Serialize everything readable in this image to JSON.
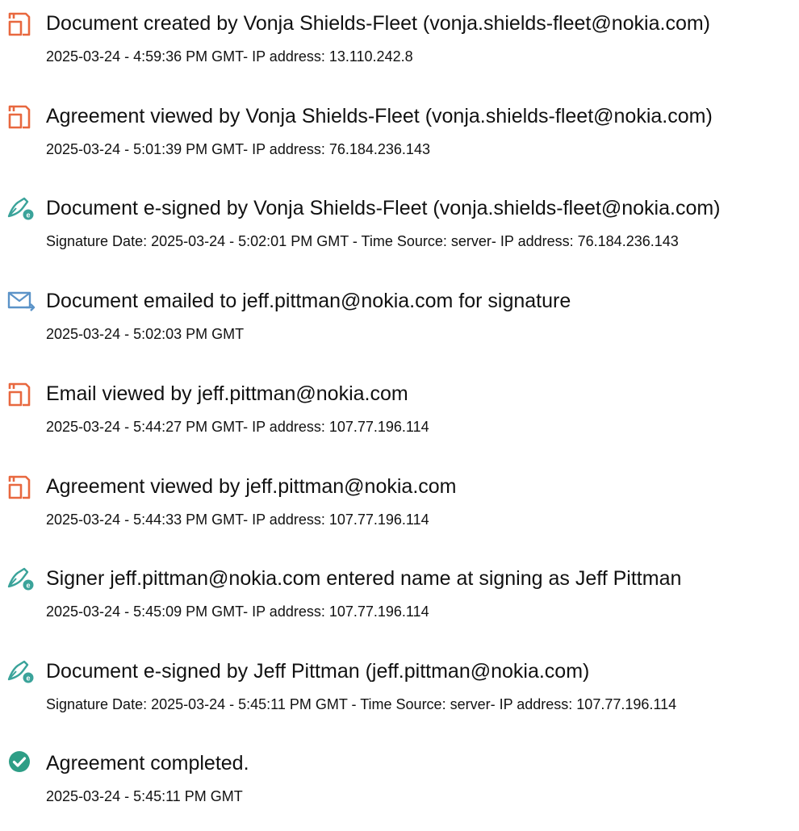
{
  "colors": {
    "document_icon": "#e8683f",
    "sign_icon": "#3aa39a",
    "email_icon": "#5b93c8",
    "complete_icon": "#2e9e86",
    "text": "#111111"
  },
  "events": [
    {
      "icon": "document-icon",
      "title": "Document created by Vonja Shields-Fleet (vonja.shields-fleet@nokia.com)",
      "detail": "2025-03-24 - 4:59:36 PM GMT- IP address: 13.110.242.8"
    },
    {
      "icon": "document-icon",
      "title": "Agreement viewed by Vonja Shields-Fleet (vonja.shields-fleet@nokia.com)",
      "detail": "2025-03-24 - 5:01:39 PM GMT- IP address: 76.184.236.143"
    },
    {
      "icon": "e-sign-pen-icon",
      "title": "Document e-signed by Vonja Shields-Fleet (vonja.shields-fleet@nokia.com)",
      "detail": "Signature Date: 2025-03-24 - 5:02:01 PM GMT - Time Source: server- IP address: 76.184.236.143"
    },
    {
      "icon": "email-send-icon",
      "title": "Document emailed to jeff.pittman@nokia.com for signature",
      "detail": "2025-03-24 - 5:02:03 PM GMT"
    },
    {
      "icon": "document-icon",
      "title": "Email viewed by jeff.pittman@nokia.com",
      "detail": "2025-03-24 - 5:44:27 PM GMT- IP address: 107.77.196.114"
    },
    {
      "icon": "document-icon",
      "title": "Agreement viewed by jeff.pittman@nokia.com",
      "detail": "2025-03-24 - 5:44:33 PM GMT- IP address: 107.77.196.114"
    },
    {
      "icon": "e-sign-pen-icon",
      "title": "Signer jeff.pittman@nokia.com entered name at signing as Jeff Pittman",
      "detail": "2025-03-24 - 5:45:09 PM GMT- IP address: 107.77.196.114"
    },
    {
      "icon": "e-sign-pen-icon",
      "title": "Document e-signed by Jeff Pittman (jeff.pittman@nokia.com)",
      "detail": "Signature Date: 2025-03-24 - 5:45:11 PM GMT - Time Source: server- IP address: 107.77.196.114"
    },
    {
      "icon": "checkmark-circle-icon",
      "title": "Agreement completed.",
      "detail": "2025-03-24 - 5:45:11 PM GMT"
    }
  ]
}
